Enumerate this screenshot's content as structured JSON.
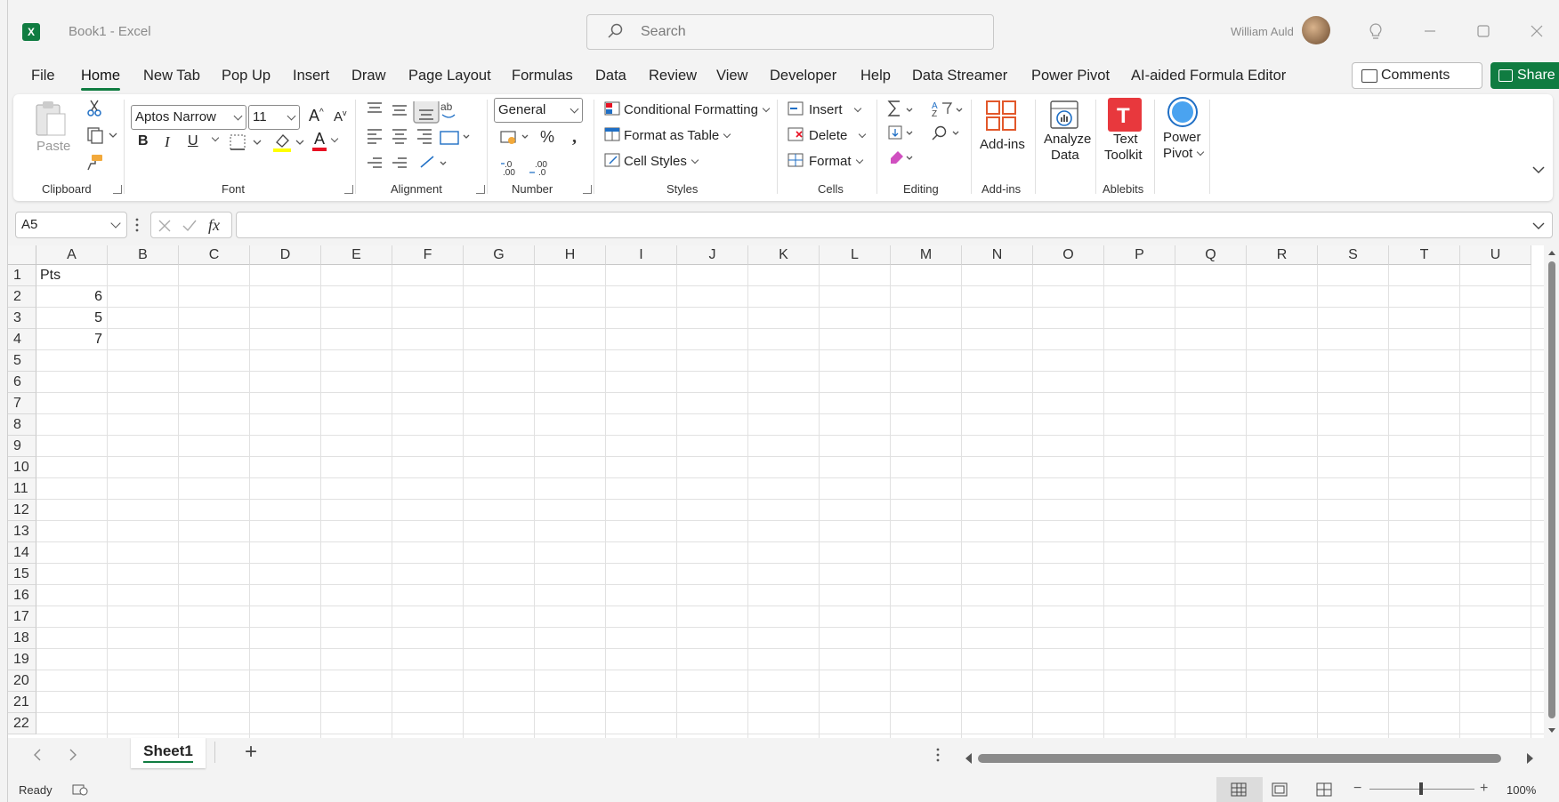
{
  "window": {
    "app_name": "Excel",
    "doc_title": "Book1  -  Excel",
    "user_name": "William Auld"
  },
  "search": {
    "placeholder": "Search"
  },
  "tabs": [
    {
      "label": "File"
    },
    {
      "label": "Home",
      "active": true
    },
    {
      "label": "New Tab"
    },
    {
      "label": "Pop Up"
    },
    {
      "label": "Insert"
    },
    {
      "label": "Draw"
    },
    {
      "label": "Page Layout"
    },
    {
      "label": "Formulas"
    },
    {
      "label": "Data"
    },
    {
      "label": "Review"
    },
    {
      "label": "View"
    },
    {
      "label": "Developer"
    },
    {
      "label": "Help"
    },
    {
      "label": "Data Streamer"
    },
    {
      "label": "Power Pivot"
    },
    {
      "label": "AI-aided Formula Editor"
    }
  ],
  "header_buttons": {
    "comments": "Comments",
    "share": "Share"
  },
  "ribbon": {
    "clipboard": {
      "paste": "Paste",
      "label": "Clipboard"
    },
    "font": {
      "name": "Aptos Narrow",
      "size": "11",
      "label": "Font",
      "bold": "B",
      "italic": "I",
      "underline": "U",
      "grow": "A",
      "shrink": "A",
      "font_color_glyph": "A"
    },
    "alignment": {
      "label": "Alignment"
    },
    "number": {
      "format": "General",
      "label": "Number"
    },
    "styles": {
      "conditional": "Conditional Formatting",
      "format_table": "Format as Table",
      "cell_styles": "Cell Styles",
      "label": "Styles"
    },
    "cells": {
      "insert": "Insert",
      "delete": "Delete",
      "format": "Format",
      "label": "Cells"
    },
    "editing": {
      "label": "Editing"
    },
    "addins": {
      "button": "Add-ins",
      "label": "Add-ins"
    },
    "analyze": {
      "line1": "Analyze",
      "line2": "Data"
    },
    "ablebits": {
      "line1": "Text",
      "line2": "Toolkit",
      "label": "Ablebits"
    },
    "power_pivot": {
      "line1": "Power",
      "line2": "Pivot"
    }
  },
  "formula_bar": {
    "name_box": "A5",
    "fx": "fx",
    "formula": ""
  },
  "columns": [
    "A",
    "B",
    "C",
    "D",
    "E",
    "F",
    "G",
    "H",
    "I",
    "J",
    "K",
    "L",
    "M",
    "N",
    "O",
    "P",
    "Q",
    "R",
    "S",
    "T",
    "U"
  ],
  "rows": [
    "1",
    "2",
    "3",
    "4",
    "5",
    "6",
    "7",
    "8",
    "9",
    "10",
    "11",
    "12",
    "13",
    "14",
    "15",
    "16",
    "17",
    "18",
    "19",
    "20",
    "21",
    "22"
  ],
  "cells": {
    "A1": "Pts",
    "A2": "6",
    "A3": "5",
    "A4": "7"
  },
  "sheets": [
    {
      "name": "Sheet1",
      "active": true
    }
  ],
  "add_sheet": "+",
  "status": {
    "ready": "Ready",
    "zoom": "100%"
  },
  "colors": {
    "accent": "#107c41",
    "font_color": "#e81123",
    "highlight": "#ffff00"
  }
}
